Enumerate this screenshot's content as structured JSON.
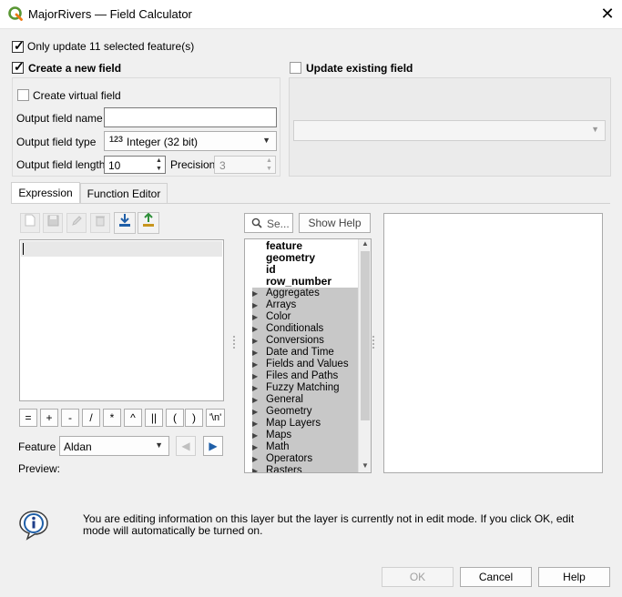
{
  "window": {
    "title": "MajorRivers — Field Calculator",
    "close_glyph": "✕"
  },
  "options": {
    "only_update_label": "Only update 11 selected feature(s)",
    "only_update_checked": true,
    "create_new_label": "Create a new field",
    "create_new_checked": true,
    "update_existing_label": "Update existing field",
    "update_existing_checked": false
  },
  "new_field": {
    "virtual_label": "Create virtual field",
    "virtual_checked": false,
    "name_label": "Output field name",
    "name_value": "",
    "type_label": "Output field type",
    "type_icon": "123",
    "type_value": "Integer (32 bit)",
    "length_label": "Output field length",
    "length_value": "10",
    "precision_label": "Precision",
    "precision_value": "3"
  },
  "existing_field": {
    "selected": ""
  },
  "tabs": [
    {
      "label": "Expression",
      "active": true
    },
    {
      "label": "Function Editor",
      "active": false
    }
  ],
  "toolbar": {
    "icons": [
      "new-file-icon",
      "save-icon",
      "edit-icon",
      "delete-icon",
      "load-icon",
      "export-icon"
    ]
  },
  "operators": [
    "=",
    "+",
    "-",
    "/",
    "*",
    "^",
    "||",
    "(",
    ")",
    "'\\n'"
  ],
  "feature": {
    "label": "Feature",
    "value": "Aldan",
    "preview_label": "Preview:"
  },
  "search": {
    "placeholder": "Se...",
    "show_help_label": "Show Help"
  },
  "tree": {
    "variables": [
      "feature",
      "geometry",
      "id",
      "row_number"
    ],
    "groups": [
      "Aggregates",
      "Arrays",
      "Color",
      "Conditionals",
      "Conversions",
      "Date and Time",
      "Fields and Values",
      "Files and Paths",
      "Fuzzy Matching",
      "General",
      "Geometry",
      "Map Layers",
      "Maps",
      "Math",
      "Operators",
      "Rasters"
    ]
  },
  "info": {
    "message": "You are editing information on this layer but the layer is currently not in edit mode. If you click OK, edit mode will automatically be turned on."
  },
  "buttons": {
    "ok": "OK",
    "cancel": "Cancel",
    "help": "Help"
  },
  "colors": {
    "accent": "#1f5fa8",
    "group_highlight": "#c8c8c8",
    "qgis_green": "#589632",
    "qgis_yellow": "#ee7913"
  }
}
